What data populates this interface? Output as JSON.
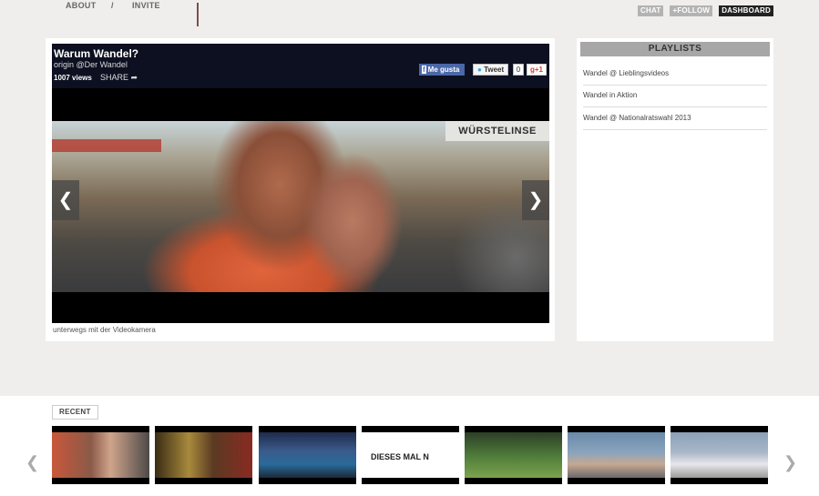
{
  "topnav": {
    "about": "ABOUT",
    "separator": "/",
    "invite": "INVITE"
  },
  "actions": {
    "chat": "CHAT",
    "follow": "+FOLLOW",
    "dashboard": "DASHBOARD"
  },
  "video": {
    "title": "Warum Wandel?",
    "origin": "origin @Der Wandel",
    "views": "1007 views",
    "share": "SHARE",
    "scene_sign": "WÜRSTELINSE",
    "caption": "unterwegs mit der Videokamera"
  },
  "social": {
    "like": "Me gusta",
    "tweet": "Tweet",
    "tweet_count": "0",
    "gplus": "g+1"
  },
  "playlists": {
    "title": "PLAYLISTS",
    "items": [
      "Wandel @ Lieblingsvideos",
      "Wandel in Aktion",
      "Wandel @ Nationalratswahl 2013"
    ]
  },
  "recent": {
    "label": "RECENT",
    "thumbnail_text": "DIESES MAL N"
  }
}
